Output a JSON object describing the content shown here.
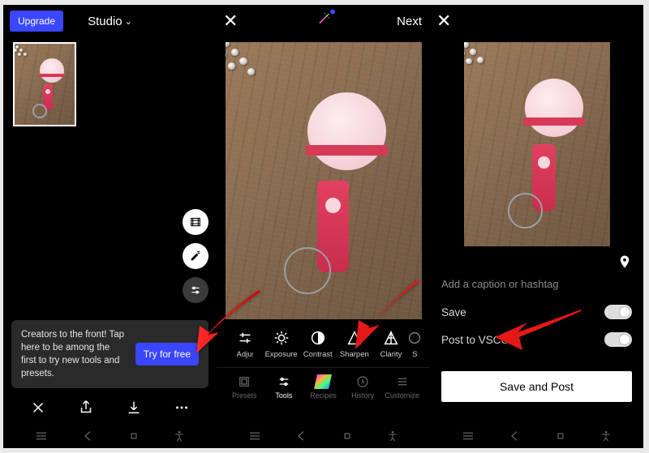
{
  "phone1": {
    "upgrade": "Upgrade",
    "title": "Studio",
    "banner_text": "Creators to the front! Tap here to be among the first to try new tools and presets.",
    "try_label": "Try for free"
  },
  "phone2": {
    "next": "Next",
    "tools": [
      {
        "label": "Adjust"
      },
      {
        "label": "Exposure"
      },
      {
        "label": "Contrast"
      },
      {
        "label": "Sharpen"
      },
      {
        "label": "Clarity"
      },
      {
        "label": "S"
      }
    ],
    "tabs": [
      {
        "label": "Presets"
      },
      {
        "label": "Tools"
      },
      {
        "label": "Recipes"
      },
      {
        "label": "History"
      },
      {
        "label": "Customize"
      }
    ]
  },
  "phone3": {
    "caption_placeholder": "Add a caption or hashtag",
    "save_label": "Save",
    "post_label": "Post to VSCO",
    "save_post": "Save and Post"
  }
}
